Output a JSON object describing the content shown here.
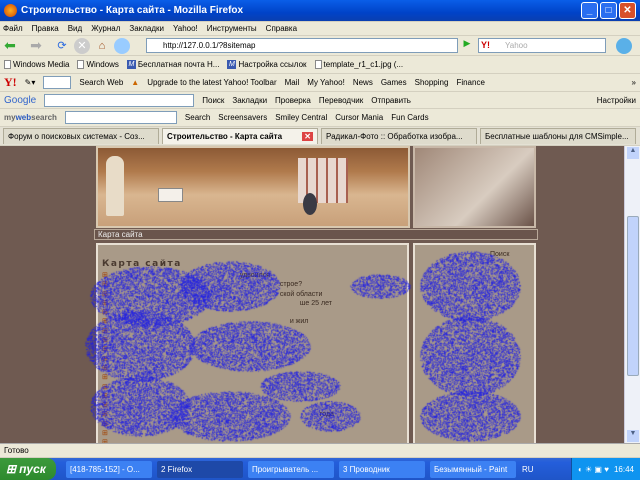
{
  "window": {
    "title": "Строительство - Карта сайта - Mozilla Firefox",
    "min": "_",
    "max": "□",
    "close": "✕"
  },
  "menu": [
    "Файл",
    "Правка",
    "Вид",
    "Журнал",
    "Закладки",
    "Yahoo!",
    "Инструменты",
    "Справка"
  ],
  "nav": {
    "url": "http://127.0.0.1/?8sitemap",
    "search_placeholder": "Yahoo",
    "search_logo": "Y!"
  },
  "bookmarks": [
    "Windows Media",
    "Windows",
    "Бесплатная почта H...",
    "Настройка ссылок",
    "template_r1_c1.jpg (..."
  ],
  "yahoo_toolbar": {
    "logo": "Y!",
    "items": [
      "Search Web",
      "Upgrade to the latest Yahoo! Toolbar",
      "Mail",
      "My Yahoo!",
      "News",
      "Games",
      "Shopping",
      "Finance"
    ],
    "more": "»"
  },
  "google_toolbar": {
    "logo": "Google",
    "items": [
      "Поиск",
      "Закладки",
      "Проверка",
      "Переводчик",
      "Отправить",
      "Настройки"
    ]
  },
  "mywebsearch": {
    "logo_my": "my",
    "logo_web": "web",
    "logo_search": "search",
    "search_btn": "Search",
    "items": [
      "Screensavers",
      "Smiley Central",
      "Cursor Mania",
      "Fun Cards"
    ]
  },
  "tabs": [
    {
      "label": "Форум о поисковых системах - Соз...",
      "active": false
    },
    {
      "label": "Строительство - Карта сайта",
      "active": true
    },
    {
      "label": "Радикал-Фото :: Обработка изобра...",
      "active": false
    },
    {
      "label": "Бесплатные шаблоны для CMSimple...",
      "active": false
    }
  ],
  "page": {
    "breadcrumb": "Карта сайта",
    "heading": "Карта сайта",
    "side_label": "Поиск",
    "items": [
      "удвоился",
      "строе?",
      "ской области",
      "ше 25 лет",
      "",
      "и жил",
      "",
      "",
      "",
      "",
      "",
      "",
      "",
      "",
      "",
      "года",
      "",
      "",
      "",
      "",
      "",
      ""
    ]
  },
  "status": "Готово",
  "taskbar": {
    "start": "пуск",
    "buttons": [
      "[418-785-152] - О...",
      "2 Firefox",
      "Проигрыватель ...",
      "3 Проводник",
      "Безымянный - Paint"
    ],
    "lang": "RU",
    "clock": "16:44"
  }
}
